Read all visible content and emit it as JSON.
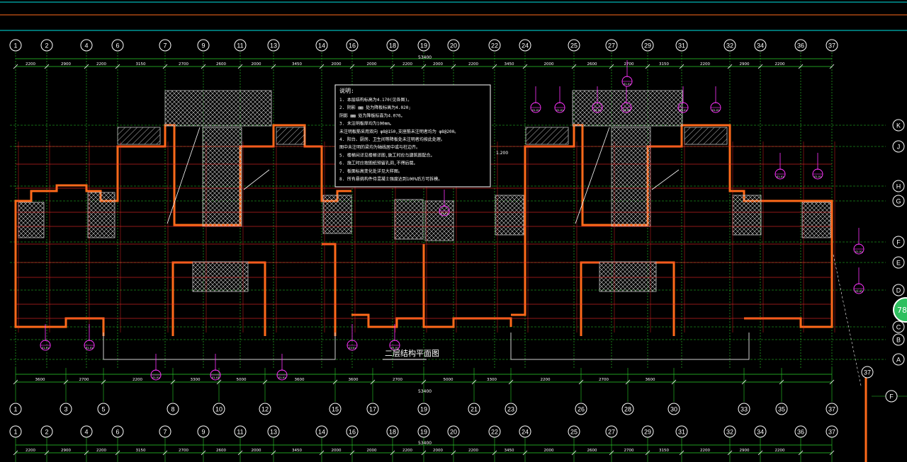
{
  "drawing": {
    "title": "二层结构平面图",
    "colors": {
      "background": "#000000",
      "axis_line": "#2bd12b",
      "wall": "#ff6a1a",
      "beam": "#ff2a2a",
      "dimension": "#2bd12b",
      "text": "#ffffff",
      "section_mark": "#ff33ff",
      "header_line_top": "#00e5e5",
      "header_line_mid": "#ff6a1a",
      "hatch": "#bfbfbf",
      "note_frame": "#ffffff",
      "zoom_badge": "#2fbf5f"
    },
    "top_axes": [
      "1",
      "2",
      "4",
      "6",
      "7",
      "9",
      "11",
      "13",
      "14",
      "16",
      "18",
      "19",
      "20",
      "22",
      "24",
      "25",
      "27",
      "29",
      "31",
      "32",
      "34",
      "36",
      "37"
    ],
    "bottom_axes": [
      "1",
      "3",
      "5",
      "8",
      "10",
      "12",
      "15",
      "17",
      "19",
      "21",
      "23",
      "26",
      "28",
      "30",
      "33",
      "35",
      "37"
    ],
    "row_axes": [
      "K",
      "J",
      "H",
      "G",
      "F",
      "E",
      "D",
      "C",
      "B",
      "A"
    ],
    "top_dimensions": [
      "2200",
      "2900",
      "2200",
      "3150",
      "2700",
      "2600",
      "2000",
      "3450",
      "2000",
      "2000",
      "2200",
      "2000",
      "2200",
      "3450",
      "2000",
      "2600",
      "2700",
      "3150",
      "2200",
      "2900",
      "2200"
    ],
    "bottom_dimensions": [
      "3600",
      "2700",
      "2200",
      "3300",
      "5000",
      "3600",
      "3600",
      "2700",
      "5000",
      "3300",
      "2200",
      "2700",
      "3600"
    ],
    "total_dimension": "53400",
    "notes": {
      "heading": "说明:",
      "lines": [
        "1. 本层结构标高为4.170(见各图)。",
        "2. 阴影 ▨▨ 处为降板标高为4.020;",
        "   阴影 ▨▨ 处为降板标高为4.070。",
        "3. 未注明板厚均为100mm。",
        "   未注明板筋采用双向 φ8@150,支座筋未注明者均为 φ8@200。",
        "4. 阳台、厨房、卫生间等降板处未注明者均按此处理。",
        "   图中未注明的梁均为轴线居中或与柱边齐。",
        "5. 楼梯间详见楼梯详图,施工时应与建筑图配合。",
        "6. 施工时应按图纸预留孔洞,不得后凿。",
        "7. 板面标高变化处详见大样图。",
        "8. 所有悬挑构件待混凝土强度达到100%后方可拆模。"
      ]
    },
    "zoom_badge": "78",
    "elevation_tag": "1.200",
    "section_mark_label": "S1-01"
  }
}
